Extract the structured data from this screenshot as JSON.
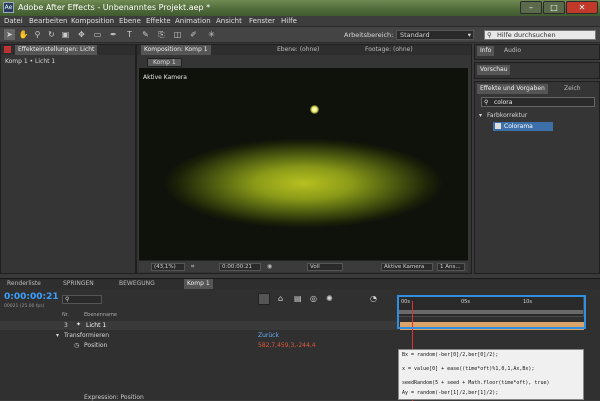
{
  "window": {
    "title": "Adobe After Effects - Unbenanntes Projekt.aep *"
  },
  "menu": [
    "Datei",
    "Bearbeiten",
    "Komposition",
    "Ebene",
    "Effekte",
    "Animation",
    "Ansicht",
    "Fenster",
    "Hilfe"
  ],
  "toolbar": {
    "workspace_label": "Arbeitsbereich:",
    "workspace_value": "Standard",
    "help_placeholder": "Hilfe durchsuchen"
  },
  "left_panel": {
    "tab": "Effekteinstellungen: Licht",
    "breadcrumb": "Komp 1 • Licht 1"
  },
  "comp_panel": {
    "tabs": [
      "Komposition: Komp 1",
      "Ebene: (ohne)",
      "Footage: (ohne)"
    ],
    "comp_tab": "Komp 1",
    "view_label": "Aktive Kamera"
  },
  "viewer_bar": {
    "zoom": "(43,1%)",
    "time": "0:00:00:21",
    "quality": "Voll",
    "camera": "Aktive Kamera",
    "views": "1 Ans..."
  },
  "right_panel": {
    "top_tabs": [
      "Info",
      "Audio"
    ],
    "preview_tab": "Vorschau",
    "effects_tab": "Effekte und Vorgaben",
    "effects_tab2": "Zeich",
    "search_value": "colora",
    "category": "Farbkorrektur",
    "effect": "Colorama"
  },
  "timeline": {
    "tabs": [
      "Renderliste",
      "SPRINGEN",
      "BEWEGUNG",
      "Komp 1"
    ],
    "timecode": "0:00:00:21",
    "timecode_sub": "00021 (25.00 fps)",
    "col_nr": "Nr.",
    "col_name": "Ebenenname",
    "ruler": [
      "00s",
      "05s",
      "10s"
    ],
    "layer_num": "3",
    "layer_name": "Licht 1",
    "transform": "Transformieren",
    "reset": "Zurück",
    "position_label": "Position",
    "position_value": "582,7,459,3,-244,4",
    "expression_label": "Expression: Position"
  },
  "expression_lines": [
    "Bx = random(-ber[0]/2,ber[0]/2);",
    "x = value[0] + ease((time*oft)%1,0,1,Ax,Bx);",
    "seedRandom(5 + seed + Math.floor(time*oft), true)",
    "Ay = random(-ber[1]/2,ber[1]/2);"
  ],
  "colors": {
    "accent": "#f0a030",
    "timecode": "#3aa0ff",
    "position_value": "#e05a3a"
  }
}
